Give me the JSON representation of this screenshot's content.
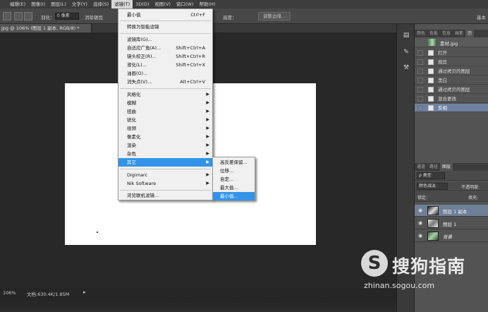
{
  "menubar": {
    "items": [
      "编辑(E)",
      "图像(I)",
      "图层(L)",
      "文字(Y)",
      "选择(S)",
      "滤镜(T)",
      "3D(D)",
      "视图(V)",
      "窗口(W)",
      "帮助(H)"
    ],
    "active": "滤镜(T)"
  },
  "options": {
    "feather_label": "羽化：",
    "feather_value": "0 像素",
    "antialias": "消除锯齿",
    "style_label": "样式：",
    "height_label": "高度：",
    "refine_button": "调整边缘...",
    "workspace": "基本"
  },
  "document": {
    "tab_title": "jpg @ 106% (图层 1 副本, RGB/8) *",
    "zoom": "106%",
    "doc_size": "文档:630.4K/1.85M"
  },
  "filter_menu": {
    "last_filter": "最小值",
    "last_filter_shortcut": "Ctrl+F",
    "convert_smart": "转换为智能滤镜",
    "gallery": "滤镜库(G)...",
    "adaptive_wide": "自适应广角(A)...",
    "adaptive_wide_shortcut": "Shift+Ctrl+A",
    "lens_correction": "镜头校正(R)...",
    "lens_correction_shortcut": "Shift+Ctrl+R",
    "liquify": "液化(L)...",
    "liquify_shortcut": "Shift+Ctrl+X",
    "oil_paint": "油画(O)...",
    "vanishing_point": "消失点(V)...",
    "vanishing_point_shortcut": "Alt+Ctrl+V",
    "groups": [
      "风格化",
      "模糊",
      "扭曲",
      "锐化",
      "视频",
      "像素化",
      "渲染",
      "杂色",
      "其它"
    ],
    "highlighted": "其它",
    "plugins": [
      "Digimarc",
      "Nik Software"
    ],
    "browse_online": "浏览联机滤镜..."
  },
  "other_submenu": {
    "items": [
      "高反差保留...",
      "位移...",
      "自定...",
      "最大值...",
      "最小值..."
    ],
    "highlighted": "最小值..."
  },
  "history_panel": {
    "tabs": [
      "颜色",
      "色板",
      "信息",
      "画笔",
      "历"
    ],
    "active_tab": "历",
    "snapshot": "素材.jpg",
    "states": [
      "打开",
      "裁剪",
      "通过拷贝的图层",
      "黑白",
      "通过拷贝的图层",
      "混合更改",
      "反相"
    ],
    "selected_state": "反相"
  },
  "layers_panel": {
    "tabs": [
      "通道",
      "路径",
      "图层"
    ],
    "active_tab": "图层",
    "kind_filter": "ρ 类型",
    "blend_mode": "颜色减淡",
    "opacity_label": "不透明度:",
    "lock_label": "锁定:",
    "fill_label": "填充:",
    "layers": [
      {
        "name": "图层 1 副本",
        "selected": true
      },
      {
        "name": "图层 1",
        "selected": false
      },
      {
        "name": "背景",
        "selected": false
      }
    ]
  },
  "watermark": {
    "logo_letter": "S",
    "brand": "搜狗指南",
    "url": "zhinan.sogou.com"
  }
}
